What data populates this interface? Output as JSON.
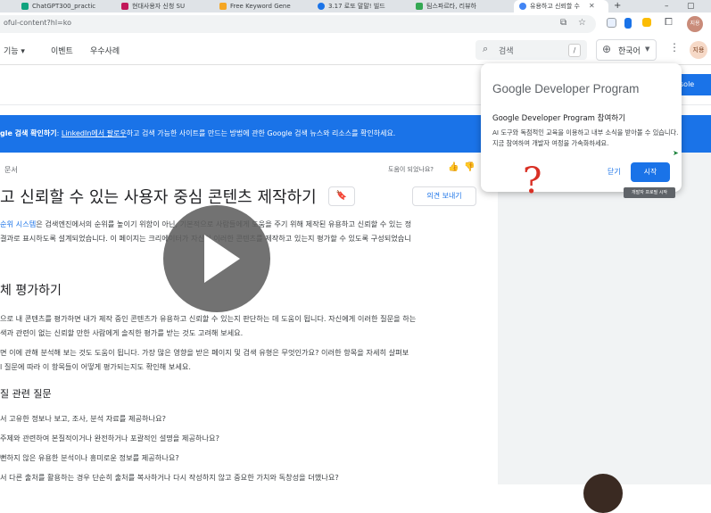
{
  "browser": {
    "tabs": [
      {
        "label": "ChatGPT300_practic",
        "color": "#10a37f"
      },
      {
        "label": "현대사용자 신청 SU",
        "color": "#c2185b"
      },
      {
        "label": "Free Keyword Gene",
        "color": "#f5a623"
      },
      {
        "label": "3.17 로또 말말! 빌드",
        "color": "#1a73e8"
      },
      {
        "label": "팀스파르타, 리뷰하",
        "color": "#34a853"
      },
      {
        "label": "유용하고 신뢰할 수",
        "color": "#4285f4"
      }
    ],
    "new_tab": "+",
    "url": "oful-content?hl=ko",
    "profile_initials": "지용"
  },
  "site_nav": {
    "items": [
      "기능 ▾",
      "이벤트",
      "우수사례"
    ],
    "search_label": "검색",
    "search_shortcut": "/",
    "language": "한국어",
    "avatar_initials": "지용",
    "console_label": "sole"
  },
  "banner": {
    "lead": "gle 검색 확인하기",
    "link": "LinkedIn에서 팔로우",
    "rest": "하고 검색 가능한 사이트를 만드는 방법에 관한 Google 검색 뉴스와 리소스를 확인하세요."
  },
  "article": {
    "breadcrumb": "문서",
    "helpful_label": "도움이 되었나요?",
    "title": "고 신뢰할 수 있는 사용자 중심 콘텐츠 제작하기",
    "feedback_label": "의견 보내기",
    "intro_link": "순위 시스템",
    "intro_line1": "은 검색엔진에서의 순위를 높이기 위함이 아닌, 기본적으로 사람들에게 도움을 주기 위해 제작된 유용하고 신뢰할 수 있는 정",
    "intro_line2": "결과로 표시하도록 설계되었습니다. 이 페이지는 크리에이터가 자신이 이러한 콘텐츠를 제작하고 있는지 평가할 수 있도록 구성되었습니",
    "section_heading": "체 평가하기",
    "para1_line1": "으로 내 콘텐츠를 평가하면 내가 제작 중인 콘텐츠가 유용하고 신뢰할 수 있는지 판단하는 데 도움이 됩니다. 자신에게 이러한 질문을 하는",
    "para1_line2": "색과 관련이 없는 신뢰할 만한 사람에게 솔직한 평가를 받는 것도 고려해 보세요.",
    "para2_line1": "면 이에 관해 분석해 보는 것도 도움이 됩니다. 가장 많은 영향을 받은 페이지 및 검색 유형은 무엇인가요? 이러한 항목을 자세히 살펴보",
    "para2_line2": "l 질문에 따라 이 항목들이 어떻게 평가되는지도 확인해 보세요.",
    "sub_heading": "질 관련 질문",
    "questions": [
      "서 고유한 정보나 보고, 조사, 분석 자료를 제공하나요?",
      "주제와 관련하여 본질적이거나 완전하거나 포괄적인 설명을 제공하나요?",
      "뻔하지 않은 유용한 분석이나 흥미로운 정보를 제공하나요?",
      "서 다른 출처를 활용하는 경우 단순히 출처를 복사하거나 다시 작성하지 않고 중요한 가치와 독창성을 더했나요?"
    ]
  },
  "popup": {
    "brand": "Google Developer Program",
    "heading": "Google Developer Program 참여하기",
    "body": "AI 도구와 독점적인 교육을 이용하고 내부 소식을 받아볼 수 있습니다. 지금 참여하여 개발자 여정을 가속화하세요.",
    "close_label": "닫기",
    "start_label": "시작",
    "tooltip": "개발자 프로필 시작"
  },
  "annotation": "?"
}
